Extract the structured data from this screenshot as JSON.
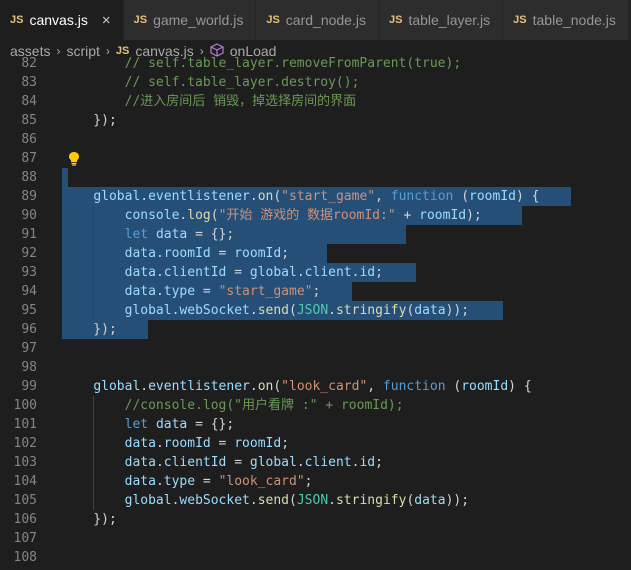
{
  "tabs": [
    {
      "label": "canvas.js",
      "active": true,
      "close": "×"
    },
    {
      "label": "game_world.js",
      "active": false
    },
    {
      "label": "card_node.js",
      "active": false
    },
    {
      "label": "table_layer.js",
      "active": false
    },
    {
      "label": "table_node.js",
      "active": false
    }
  ],
  "file_badge": "JS",
  "breadcrumb": {
    "parts": [
      "assets",
      "script",
      "canvas.js",
      "onLoad"
    ]
  },
  "colors": {
    "selection": "#264f78",
    "keyword": "#569cd6",
    "string": "#ce9178",
    "variable": "#9cdcfe",
    "function": "#dcdcaa",
    "comment": "#6a9955",
    "type": "#4ec9b0"
  },
  "lines": [
    {
      "n": "82",
      "tokens": [
        [
          "c",
          "        // self.table_layer.removeFromParent(true);"
        ]
      ]
    },
    {
      "n": "83",
      "tokens": [
        [
          "c",
          "        // self.table_layer.destroy();"
        ]
      ]
    },
    {
      "n": "84",
      "tokens": [
        [
          "c",
          "        //进入房间后 销毁，掉选择房间的界面"
        ]
      ]
    },
    {
      "n": "85",
      "tokens": [
        [
          "p",
          "    });"
        ]
      ]
    },
    {
      "n": "86",
      "tokens": []
    },
    {
      "n": "87",
      "tokens": [],
      "bulb": true
    },
    {
      "n": "88",
      "tokens": []
    },
    {
      "n": "89",
      "tokens": [
        [
          "p",
          "    "
        ],
        [
          "v",
          "global"
        ],
        [
          "p",
          "."
        ],
        [
          "v",
          "eventlistener"
        ],
        [
          "p",
          "."
        ],
        [
          "f",
          "on"
        ],
        [
          "p",
          "("
        ],
        [
          "s",
          "\"start_game\""
        ],
        [
          "p",
          ", "
        ],
        [
          "k",
          "function"
        ],
        [
          "p",
          " ("
        ],
        [
          "v",
          "roomId"
        ],
        [
          "p",
          ") {"
        ]
      ]
    },
    {
      "n": "90",
      "tokens": [
        [
          "p",
          "        "
        ],
        [
          "v",
          "console"
        ],
        [
          "p",
          "."
        ],
        [
          "f",
          "log"
        ],
        [
          "p",
          "("
        ],
        [
          "s",
          "\"开始 游戏的 数据roomId:\""
        ],
        [
          "p",
          " + "
        ],
        [
          "v",
          "roomId"
        ],
        [
          "p",
          ");"
        ]
      ]
    },
    {
      "n": "91",
      "tokens": [
        [
          "p",
          "        "
        ],
        [
          "k",
          "let"
        ],
        [
          "p",
          " "
        ],
        [
          "v",
          "data"
        ],
        [
          "p",
          " = {};"
        ]
      ]
    },
    {
      "n": "92",
      "tokens": [
        [
          "p",
          "        "
        ],
        [
          "v",
          "data"
        ],
        [
          "p",
          "."
        ],
        [
          "v",
          "roomId"
        ],
        [
          "p",
          " = "
        ],
        [
          "v",
          "roomId"
        ],
        [
          "p",
          ";"
        ]
      ]
    },
    {
      "n": "93",
      "tokens": [
        [
          "p",
          "        "
        ],
        [
          "v",
          "data"
        ],
        [
          "p",
          "."
        ],
        [
          "v",
          "clientId"
        ],
        [
          "p",
          " = "
        ],
        [
          "v",
          "global"
        ],
        [
          "p",
          "."
        ],
        [
          "v",
          "client"
        ],
        [
          "p",
          "."
        ],
        [
          "v",
          "id"
        ],
        [
          "p",
          ";"
        ]
      ]
    },
    {
      "n": "94",
      "tokens": [
        [
          "p",
          "        "
        ],
        [
          "v",
          "data"
        ],
        [
          "p",
          "."
        ],
        [
          "v",
          "type"
        ],
        [
          "p",
          " = "
        ],
        [
          "s",
          "\"start_game\""
        ],
        [
          "p",
          ";"
        ]
      ]
    },
    {
      "n": "95",
      "tokens": [
        [
          "p",
          "        "
        ],
        [
          "v",
          "global"
        ],
        [
          "p",
          "."
        ],
        [
          "v",
          "webSocket"
        ],
        [
          "p",
          "."
        ],
        [
          "f",
          "send"
        ],
        [
          "p",
          "("
        ],
        [
          "t",
          "JSON"
        ],
        [
          "p",
          "."
        ],
        [
          "f",
          "stringify"
        ],
        [
          "p",
          "("
        ],
        [
          "v",
          "data"
        ],
        [
          "p",
          "));"
        ]
      ]
    },
    {
      "n": "96",
      "tokens": [
        [
          "p",
          "    });"
        ]
      ]
    },
    {
      "n": "97",
      "tokens": []
    },
    {
      "n": "98",
      "tokens": []
    },
    {
      "n": "99",
      "tokens": [
        [
          "p",
          "    "
        ],
        [
          "v",
          "global"
        ],
        [
          "p",
          "."
        ],
        [
          "v",
          "eventlistener"
        ],
        [
          "p",
          "."
        ],
        [
          "f",
          "on"
        ],
        [
          "p",
          "("
        ],
        [
          "s",
          "\"look_card\""
        ],
        [
          "p",
          ", "
        ],
        [
          "k",
          "function"
        ],
        [
          "p",
          " ("
        ],
        [
          "v",
          "roomId"
        ],
        [
          "p",
          ") {"
        ]
      ]
    },
    {
      "n": "100",
      "tokens": [
        [
          "c",
          "        //console.log(\"用户看牌 :\" + roomId);"
        ]
      ]
    },
    {
      "n": "101",
      "tokens": [
        [
          "p",
          "        "
        ],
        [
          "k",
          "let"
        ],
        [
          "p",
          " "
        ],
        [
          "v",
          "data"
        ],
        [
          "p",
          " = {};"
        ]
      ]
    },
    {
      "n": "102",
      "tokens": [
        [
          "p",
          "        "
        ],
        [
          "v",
          "data"
        ],
        [
          "p",
          "."
        ],
        [
          "v",
          "roomId"
        ],
        [
          "p",
          " = "
        ],
        [
          "v",
          "roomId"
        ],
        [
          "p",
          ";"
        ]
      ]
    },
    {
      "n": "103",
      "tokens": [
        [
          "p",
          "        "
        ],
        [
          "v",
          "data"
        ],
        [
          "p",
          "."
        ],
        [
          "v",
          "clientId"
        ],
        [
          "p",
          " = "
        ],
        [
          "v",
          "global"
        ],
        [
          "p",
          "."
        ],
        [
          "v",
          "client"
        ],
        [
          "p",
          "."
        ],
        [
          "v",
          "id"
        ],
        [
          "p",
          ";"
        ]
      ]
    },
    {
      "n": "104",
      "tokens": [
        [
          "p",
          "        "
        ],
        [
          "v",
          "data"
        ],
        [
          "p",
          "."
        ],
        [
          "v",
          "type"
        ],
        [
          "p",
          " = "
        ],
        [
          "s",
          "\"look_card\""
        ],
        [
          "p",
          ";"
        ]
      ]
    },
    {
      "n": "105",
      "tokens": [
        [
          "p",
          "        "
        ],
        [
          "v",
          "global"
        ],
        [
          "p",
          "."
        ],
        [
          "v",
          "webSocket"
        ],
        [
          "p",
          "."
        ],
        [
          "f",
          "send"
        ],
        [
          "p",
          "("
        ],
        [
          "t",
          "JSON"
        ],
        [
          "p",
          "."
        ],
        [
          "f",
          "stringify"
        ],
        [
          "p",
          "("
        ],
        [
          "v",
          "data"
        ],
        [
          "p",
          "));"
        ]
      ]
    },
    {
      "n": "106",
      "tokens": [
        [
          "p",
          "    });"
        ]
      ]
    },
    {
      "n": "107",
      "tokens": []
    },
    {
      "n": "108",
      "tokens": []
    }
  ]
}
